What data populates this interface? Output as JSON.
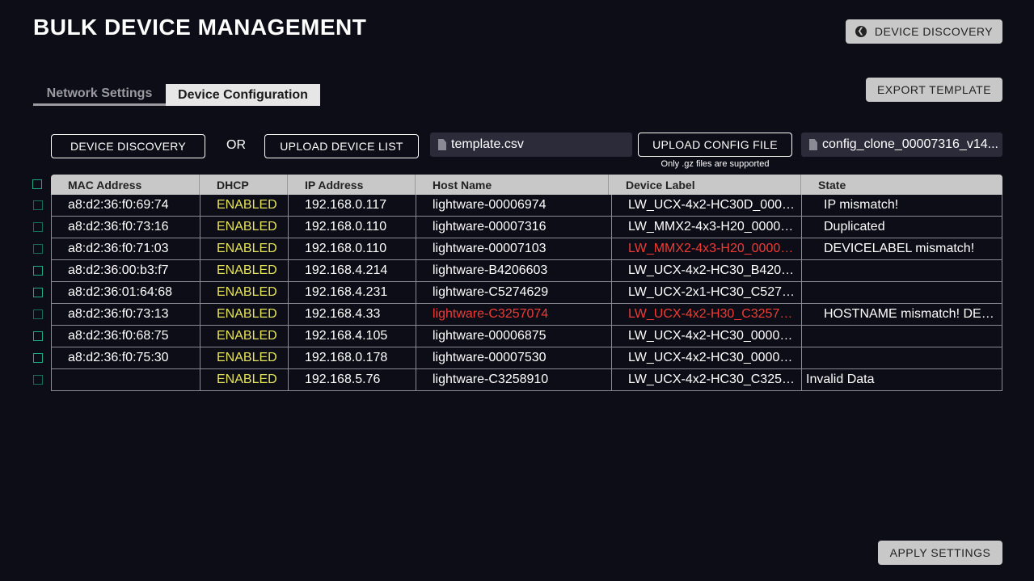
{
  "header": {
    "title": "BULK DEVICE MANAGEMENT",
    "discovery_button": "DEVICE DISCOVERY",
    "export_button": "EXPORT TEMPLATE"
  },
  "tabs": [
    {
      "label": "Network Settings",
      "active": false
    },
    {
      "label": "Device Configuration",
      "active": true
    }
  ],
  "toolbar": {
    "discovery_button": "DEVICE DISCOVERY",
    "or_text": "OR",
    "upload_list_button": "UPLOAD DEVICE LIST",
    "template_file": "template.csv",
    "upload_config_button": "UPLOAD CONFIG FILE",
    "config_file": "config_clone_00007316_v14...",
    "config_note": "Only .gz files are supported"
  },
  "table": {
    "columns": [
      "MAC Address",
      "DHCP",
      "IP Address",
      "Host Name",
      "Device Label",
      "State"
    ],
    "rows": [
      {
        "mac": "a8:d2:36:f0:69:74",
        "dhcp": "ENABLED",
        "ip": "192.168.0.117",
        "host": "lightware-00006974",
        "label": "LW_UCX-4x2-HC30D_00006...",
        "state": "IP mismatch!",
        "host_err": false,
        "label_err": false,
        "checked": false
      },
      {
        "mac": "a8:d2:36:f0:73:16",
        "dhcp": "ENABLED",
        "ip": "192.168.0.110",
        "host": "lightware-00007316",
        "label": "LW_MMX2-4x3-H20_000073...",
        "state": "Duplicated",
        "host_err": false,
        "label_err": false,
        "checked": false
      },
      {
        "mac": "a8:d2:36:f0:71:03",
        "dhcp": "ENABLED",
        "ip": "192.168.0.110",
        "host": "lightware-00007103",
        "label": "LW_MMX2-4x3-H20_000071...",
        "state": "DEVICELABEL mismatch!",
        "host_err": false,
        "label_err": true,
        "checked": false
      },
      {
        "mac": "a8:d2:36:00:b3:f7",
        "dhcp": "ENABLED",
        "ip": "192.168.4.214",
        "host": "lightware-B4206603",
        "label": "LW_UCX-4x2-HC30_B42066...",
        "state": "",
        "host_err": false,
        "label_err": false,
        "checked": true
      },
      {
        "mac": "a8:d2:36:01:64:68",
        "dhcp": "ENABLED",
        "ip": "192.168.4.231",
        "host": "lightware-C5274629",
        "label": "LW_UCX-2x1-HC30_C52746...",
        "state": "",
        "host_err": false,
        "label_err": false,
        "checked": true
      },
      {
        "mac": "a8:d2:36:f0:73:13",
        "dhcp": "ENABLED",
        "ip": "192.168.4.33",
        "host": "lightware-C3257074",
        "label": "LW_UCX-4x2-H30_C3257074",
        "state": "HOSTNAME mismatch! DEVI...",
        "host_err": true,
        "label_err": true,
        "checked": false
      },
      {
        "mac": "a8:d2:36:f0:68:75",
        "dhcp": "ENABLED",
        "ip": "192.168.4.105",
        "host": "lightware-00006875",
        "label": "LW_UCX-4x2-HC30_000068...",
        "state": "",
        "host_err": false,
        "label_err": false,
        "checked": true
      },
      {
        "mac": "a8:d2:36:f0:75:30",
        "dhcp": "ENABLED",
        "ip": "192.168.0.178",
        "host": "lightware-00007530",
        "label": "LW_UCX-4x2-HC30_000075...",
        "state": "",
        "host_err": false,
        "label_err": false,
        "checked": true
      },
      {
        "mac": "",
        "dhcp": "ENABLED",
        "ip": "192.168.5.76",
        "host": "lightware-C3258910",
        "label": "LW_UCX-4x2-HC30_C32589...",
        "state": "Invalid Data",
        "host_err": false,
        "label_err": false,
        "checked": false,
        "state_flush": true
      }
    ]
  },
  "footer": {
    "apply_button": "APPLY SETTINGS"
  },
  "colors": {
    "background": "#0d0d17",
    "enabled": "#e6e45a",
    "error": "#ef3b33",
    "checkbox": "#1fa98a"
  },
  "icons": {
    "back": "chevron-left-circle-icon",
    "file": "file-icon"
  }
}
